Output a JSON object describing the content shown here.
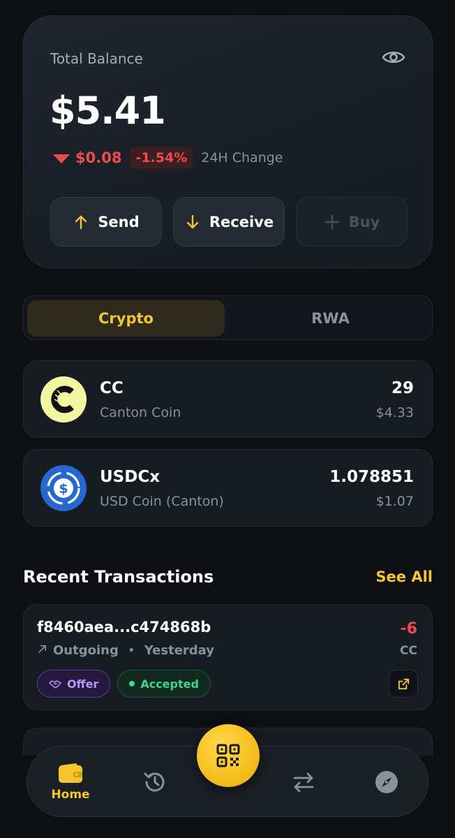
{
  "balance": {
    "label": "Total Balance",
    "amount": "$5.41",
    "change_amount": "$0.08",
    "change_percent": "-1.54%",
    "change_label": "24H Change",
    "visibility_icon": "eye-icon"
  },
  "actions": {
    "send": "Send",
    "receive": "Receive",
    "buy": "Buy"
  },
  "tabs": {
    "crypto": "Crypto",
    "rwa": "RWA",
    "active": "Crypto"
  },
  "assets": [
    {
      "symbol": "CC",
      "name": "Canton Coin",
      "quantity": "29",
      "value": "$4.33",
      "icon": "canton-coin-icon"
    },
    {
      "symbol": "USDCx",
      "name": "USD Coin (Canton)",
      "quantity": "1.078851",
      "value": "$1.07",
      "icon": "usdc-icon"
    }
  ],
  "recent": {
    "title": "Recent Transactions",
    "see_all": "See All",
    "transactions": [
      {
        "hash": "f8460aea...c474868b",
        "direction": "Outgoing",
        "date": "Yesterday",
        "amount": "-6",
        "unit": "CC",
        "type_badge": "Offer",
        "status_badge": "Accepted"
      }
    ]
  },
  "nav": {
    "home": "Home",
    "active": "Home"
  },
  "colors": {
    "accent": "#f5c431",
    "negative": "#ef4b4b",
    "positive": "#3ed68b",
    "offer": "#b693ff",
    "background": "#0d0f12"
  }
}
